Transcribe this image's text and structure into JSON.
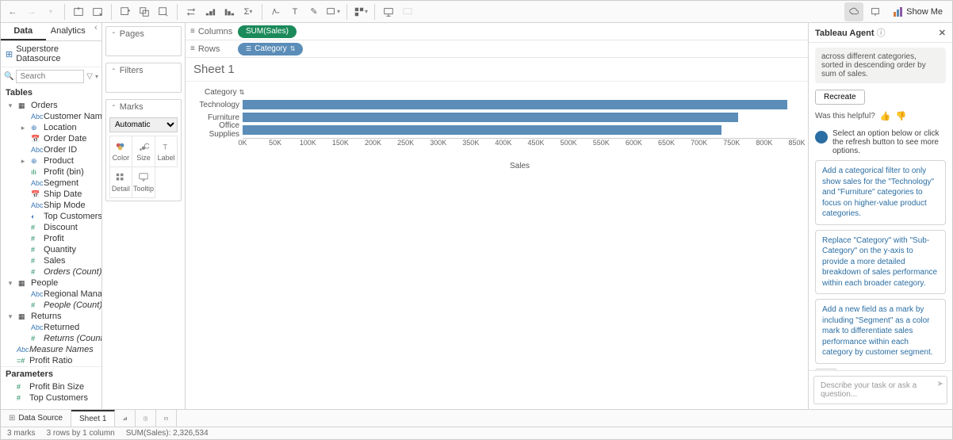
{
  "toolbar": {
    "showme": "Show Me"
  },
  "data_pane": {
    "tabs": {
      "data": "Data",
      "analytics": "Analytics"
    },
    "datasource": "Superstore Datasource",
    "search_placeholder": "Search",
    "tables_hdr": "Tables",
    "parameters_hdr": "Parameters",
    "tables": {
      "orders": "Orders",
      "orders_fields": [
        {
          "icon": "Abc",
          "cls": "blue",
          "label": "Customer Name"
        },
        {
          "icon": "⊕",
          "cls": "blue",
          "label": "Location",
          "exp": true
        },
        {
          "icon": "📅",
          "cls": "blue",
          "label": "Order Date"
        },
        {
          "icon": "Abc",
          "cls": "blue",
          "label": "Order ID"
        },
        {
          "icon": "⊕",
          "cls": "blue",
          "label": "Product",
          "exp": true
        },
        {
          "icon": "ılı",
          "cls": "green",
          "label": "Profit (bin)"
        },
        {
          "icon": "Abc",
          "cls": "blue",
          "label": "Segment"
        },
        {
          "icon": "📅",
          "cls": "blue",
          "label": "Ship Date"
        },
        {
          "icon": "Abc",
          "cls": "blue",
          "label": "Ship Mode"
        },
        {
          "icon": "◐",
          "cls": "blue",
          "label": "Top Customers by P..."
        },
        {
          "icon": "#",
          "cls": "green",
          "label": "Discount"
        },
        {
          "icon": "#",
          "cls": "green",
          "label": "Profit"
        },
        {
          "icon": "#",
          "cls": "green",
          "label": "Quantity"
        },
        {
          "icon": "#",
          "cls": "green",
          "label": "Sales"
        },
        {
          "icon": "#",
          "cls": "green italic",
          "label": "Orders (Count)"
        }
      ],
      "people": "People",
      "people_fields": [
        {
          "icon": "Abc",
          "cls": "blue",
          "label": "Regional Manager"
        },
        {
          "icon": "#",
          "cls": "green italic",
          "label": "People (Count)"
        }
      ],
      "returns": "Returns",
      "returns_fields": [
        {
          "icon": "Abc",
          "cls": "blue",
          "label": "Returned"
        },
        {
          "icon": "#",
          "cls": "green italic",
          "label": "Returns (Count)"
        }
      ],
      "loose": [
        {
          "icon": "Abc",
          "cls": "blue italic",
          "label": "Measure Names"
        },
        {
          "icon": "=#",
          "cls": "green",
          "label": "Profit Ratio"
        }
      ],
      "params": [
        {
          "icon": "#",
          "cls": "green",
          "label": "Profit Bin Size"
        },
        {
          "icon": "#",
          "cls": "green",
          "label": "Top Customers"
        }
      ]
    }
  },
  "shelves": {
    "pages": "Pages",
    "filters": "Filters",
    "marks": "Marks",
    "mark_type": "Automatic",
    "cells": {
      "color": "Color",
      "size": "Size",
      "label": "Label",
      "detail": "Detail",
      "tooltip": "Tooltip"
    }
  },
  "ws": {
    "columns": "Columns",
    "rows": "Rows",
    "col_pill": "SUM(Sales)",
    "row_pill": "Category",
    "sheet_title": "Sheet 1",
    "category_hdr": "Category",
    "axis_label": "Sales"
  },
  "chart_data": {
    "type": "bar",
    "orientation": "horizontal",
    "categories": [
      "Technology",
      "Furniture",
      "Office Supplies"
    ],
    "values": [
      836000,
      760000,
      735000
    ],
    "xlabel": "Sales",
    "xlim": [
      0,
      850000
    ],
    "ticks": [
      "0K",
      "50K",
      "100K",
      "150K",
      "200K",
      "250K",
      "300K",
      "350K",
      "400K",
      "450K",
      "500K",
      "550K",
      "600K",
      "650K",
      "700K",
      "750K",
      "800K",
      "850K"
    ]
  },
  "agent": {
    "title": "Tableau Agent",
    "context": "across different categories, sorted in descending order by sum of sales.",
    "recreate": "Recreate",
    "helpful": "Was this helpful?",
    "prompt": "Select an option below or click the refresh button to see more options.",
    "suggestions": [
      "Add a categorical filter to only show sales for the \"Technology\" and \"Furniture\" categories to focus on higher-value product categories.",
      "Replace \"Category\" with \"Sub-Category\" on the y-axis to provide a more detailed breakdown of sales performance within each broader category.",
      "Add a new field as a mark by including \"Segment\" as a color mark to differentiate sales performance within each category by customer segment."
    ],
    "input_placeholder": "Describe your task or ask a question..."
  },
  "bottom": {
    "data_source": "Data Source",
    "sheet": "Sheet 1"
  },
  "status": {
    "marks": "3 marks",
    "rows": "3 rows by 1 column",
    "sum": "SUM(Sales): 2,326,534"
  }
}
